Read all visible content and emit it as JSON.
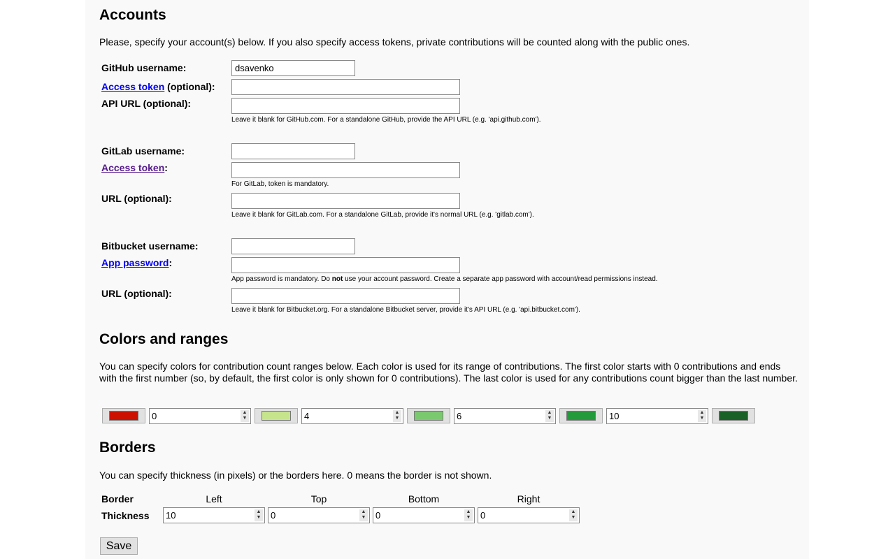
{
  "accounts": {
    "title": "Accounts",
    "description": "Please, specify your account(s) below. If you also specify access tokens, private contributions will be counted along with the public ones.",
    "github": {
      "username_label": "GitHub username:",
      "username_value": "dsavenko",
      "token_link": "Access token",
      "token_suffix": " (optional):",
      "api_label": "API URL (optional):",
      "api_hint": "Leave it blank for GitHub.com. For a standalone GitHub, provide the API URL (e.g. 'api.github.com')."
    },
    "gitlab": {
      "username_label": "GitLab username:",
      "token_link": "Access token",
      "token_suffix": ":",
      "token_hint": "For GitLab, token is mandatory.",
      "url_label": "URL (optional):",
      "url_hint": "Leave it blank for GitLab.com. For a standalone GitLab, provide it's normal URL (e.g. 'gitlab.com')."
    },
    "bitbucket": {
      "username_label": "Bitbucket username:",
      "password_link": "App password",
      "password_suffix": ":",
      "hint_pre": "App password is mandatory. Do ",
      "hint_bold": "not",
      "hint_post": " use your account password. Create a separate app password with account/read permissions instead.",
      "url_label": "URL (optional):",
      "url_hint": "Leave it blank for Bitbucket.org. For a standalone Bitbucket server, provide it's API URL (e.g. 'api.bitbucket.com')."
    }
  },
  "colors": {
    "title": "Colors and ranges",
    "description": "You can specify colors for contribution count ranges below. Each color is used for its range of contributions. The first color starts with 0 contributions and ends with the first number (so, by default, the first color is only shown for 0 contributions). The last color is used for any contributions count bigger than the last number.",
    "swatches": [
      "#cc1100",
      "#c6e48b",
      "#7bc96f",
      "#239a3b",
      "#196127"
    ],
    "ranges": [
      "0",
      "4",
      "6",
      "10"
    ]
  },
  "borders": {
    "title": "Borders",
    "description": "You can specify thickness (in pixels) or the borders here. 0 means the border is not shown.",
    "header_label": "Border",
    "row_label": "Thickness",
    "columns": [
      "Left",
      "Top",
      "Bottom",
      "Right"
    ],
    "values": [
      "10",
      "0",
      "0",
      "0"
    ]
  },
  "save_label": "Save"
}
